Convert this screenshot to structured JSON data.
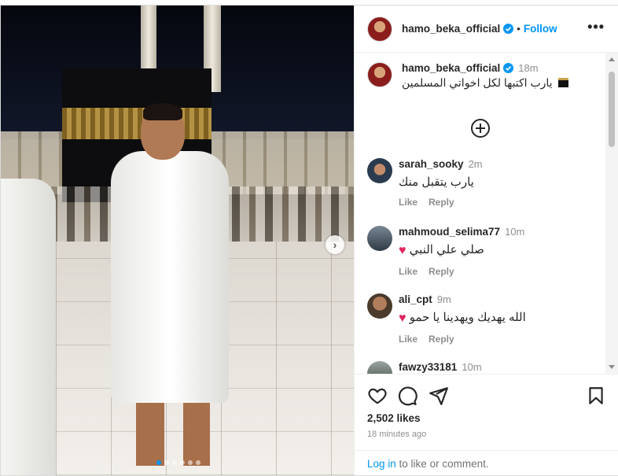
{
  "post": {
    "author": "hamo_beka_official",
    "follow_label": "Follow",
    "separator": "•",
    "more_icon": "more-options-icon"
  },
  "caption": {
    "username": "hamo_beka_official",
    "time": "18m",
    "text": "يارب اكتبها لكل اخواتي المسلمين"
  },
  "comments": [
    {
      "username": "sarah_sooky",
      "time": "2m",
      "text": "يارب يتقبل منك",
      "heart": false,
      "like_label": "Like",
      "reply_label": "Reply"
    },
    {
      "username": "mahmoud_selima77",
      "time": "10m",
      "text": "صلي علي النبي",
      "heart": true,
      "like_label": "Like",
      "reply_label": "Reply"
    },
    {
      "username": "ali_cpt",
      "time": "9m",
      "text": "الله يهديك ويهدينا يا حمو",
      "heart": true,
      "like_label": "Like",
      "reply_label": "Reply"
    },
    {
      "username": "fawzy33181",
      "time": "10m"
    }
  ],
  "likes": "2,502 likes",
  "posted_time": "18 minutes ago",
  "login": {
    "link": "Log in",
    "rest": " to like or comment."
  },
  "colors": {
    "accent": "#0095f6",
    "heart": "#e0245e",
    "text": "#262626",
    "muted": "#8e8e8e"
  }
}
